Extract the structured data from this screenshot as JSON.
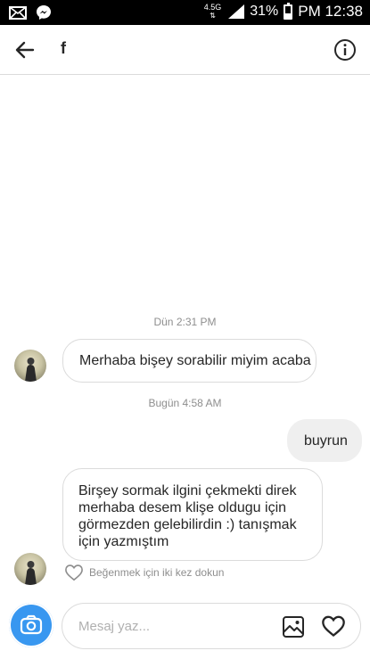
{
  "status_bar": {
    "network": "4.5G",
    "battery": "31%",
    "time": "PM 12:38",
    "icons": [
      "mail-icon",
      "messenger-icon",
      "signal-icon",
      "battery-icon"
    ]
  },
  "header": {
    "name": "f",
    "icons": [
      "back-arrow-icon",
      "info-icon"
    ]
  },
  "messages": [
    {
      "timestamp": "Dün 2:31 PM"
    },
    {
      "from": "contact",
      "text": "Merhaba bişey sorabilir miyim acaba"
    },
    {
      "timestamp": "Bugün 4:58 AM"
    },
    {
      "from": "me",
      "text": "buyrun"
    },
    {
      "from": "contact",
      "text": "Birşey sormak ilgini çekmekti direk merhaba desem klişe oldugu için görmezden gelebilirdin :) tanışmak için yazmıştım"
    }
  ],
  "like_hint": "Beğenmek için iki kez dokun",
  "composer": {
    "placeholder": "Mesaj yaz...",
    "accent_color": "#3897f0",
    "icons": [
      "camera-icon",
      "gallery-icon",
      "heart-icon"
    ]
  }
}
